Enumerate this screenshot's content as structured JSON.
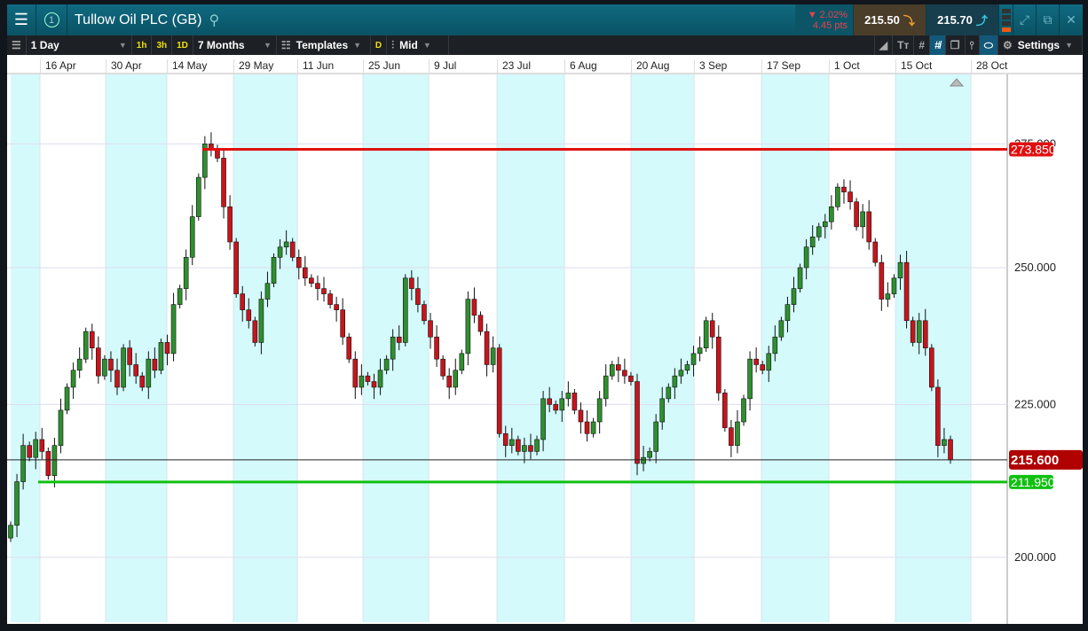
{
  "header": {
    "title": "Tullow Oil PLC (GB)",
    "change_pct": "▼ 2.02%",
    "change_pts": "4.45 pts",
    "sell": "215.50",
    "buy": "215.70",
    "order_book_index": "1"
  },
  "toolbar": {
    "interval": "1 Day",
    "quick_1h": "1h",
    "quick_3h": "3h",
    "quick_1d": "1D",
    "range": "7 Months",
    "templates": "Templates",
    "d_button": "D",
    "price_type": "Mid",
    "settings": "Settings"
  },
  "icons": [
    "menu-icon",
    "search-icon",
    "expand-icon",
    "popout-icon",
    "close-icon",
    "list-icon",
    "templates-icon",
    "candlestick-icon",
    "draw-line-icon",
    "text-icon",
    "grid-icon",
    "crosshair-icon",
    "layers-icon",
    "indicator-icon",
    "label-icon",
    "gear-icon"
  ],
  "colors": {
    "up": "#2f8f2f",
    "down": "#c8141c",
    "resistance": "#e01010",
    "support": "#10c010",
    "current": "#b00000",
    "band": "#d4fafc"
  },
  "chart_data": {
    "type": "candlestick",
    "y_scale": "log",
    "ylim": [
      190,
      285
    ],
    "grid": true,
    "x_ticks": [
      "16 Apr",
      "30 Apr",
      "14 May",
      "29 May",
      "11 Jun",
      "25 Jun",
      "9 Jul",
      "23 Jul",
      "6 Aug",
      "20 Aug",
      "3 Sep",
      "17 Sep",
      "1 Oct",
      "15 Oct",
      "28 Oct"
    ],
    "y_ticks": [
      "275.000",
      "250.000",
      "225.000",
      "200.000"
    ],
    "first_open": 203,
    "closes": [
      205,
      212,
      218,
      216,
      219,
      217,
      213,
      218,
      224,
      228,
      231,
      233,
      238,
      235,
      230,
      233,
      231,
      228,
      235,
      232,
      230,
      228,
      233,
      231,
      236,
      234,
      243,
      246,
      252,
      260,
      268,
      275,
      274,
      272,
      262,
      255,
      245,
      242,
      240,
      236,
      244,
      247,
      252,
      254,
      255,
      252,
      250,
      248,
      247,
      246,
      245,
      243,
      242,
      237,
      233,
      228,
      230,
      229,
      228,
      231,
      233,
      237,
      236,
      248,
      246,
      243,
      240,
      237,
      233,
      230,
      228,
      231,
      234,
      244,
      241,
      238,
      232,
      235,
      220,
      218,
      219,
      217,
      218,
      217,
      219,
      226,
      225,
      224,
      226,
      227,
      224,
      222,
      220,
      222,
      226,
      230,
      232,
      231,
      230,
      229,
      215,
      216,
      217,
      222,
      226,
      228,
      230,
      231,
      232,
      234,
      235,
      240,
      237,
      227,
      221,
      218,
      222,
      226,
      233,
      232,
      231,
      234,
      237,
      240,
      243,
      246,
      250,
      254,
      256,
      258,
      259,
      262,
      266,
      265,
      263,
      258,
      261,
      255,
      251,
      244,
      245,
      248,
      251,
      240,
      236,
      240,
      235,
      228,
      218,
      219,
      215.6
    ],
    "levels": [
      {
        "label": "273.850",
        "value": 273.85,
        "color": "resistance"
      },
      {
        "label": "211.950",
        "value": 211.95,
        "color": "support"
      },
      {
        "label": "215.600",
        "value": 215.6,
        "color": "current"
      }
    ]
  }
}
